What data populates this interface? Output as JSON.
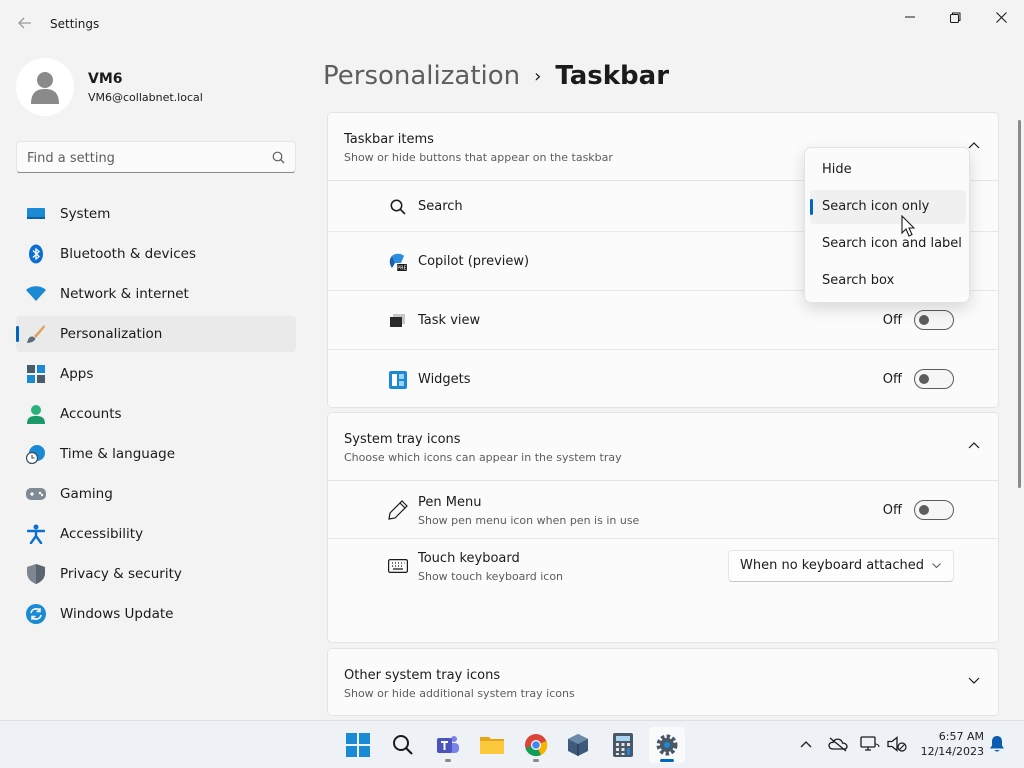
{
  "window": {
    "app_title": "Settings",
    "colors": {
      "accent": "#0067c0",
      "background": "#f3f3f3",
      "card": "#fbfbfb"
    }
  },
  "profile": {
    "name": "VM6",
    "email": "VM6@collabnet.local"
  },
  "search": {
    "placeholder": "Find a setting"
  },
  "nav": {
    "items": [
      {
        "label": "System",
        "icon": "system-icon"
      },
      {
        "label": "Bluetooth & devices",
        "icon": "bluetooth-icon"
      },
      {
        "label": "Network & internet",
        "icon": "wifi-icon"
      },
      {
        "label": "Personalization",
        "icon": "brush-icon",
        "selected": true
      },
      {
        "label": "Apps",
        "icon": "apps-icon"
      },
      {
        "label": "Accounts",
        "icon": "account-icon"
      },
      {
        "label": "Time & language",
        "icon": "globe-clock-icon"
      },
      {
        "label": "Gaming",
        "icon": "gamepad-icon"
      },
      {
        "label": "Accessibility",
        "icon": "accessibility-icon"
      },
      {
        "label": "Privacy & security",
        "icon": "shield-icon"
      },
      {
        "label": "Windows Update",
        "icon": "update-icon"
      }
    ]
  },
  "page": {
    "parent": "Personalization",
    "separator": "›",
    "current": "Taskbar"
  },
  "taskbar_items": {
    "title": "Taskbar items",
    "subtitle": "Show or hide buttons that appear on the taskbar",
    "rows": [
      {
        "label": "Search",
        "icon": "search-icon"
      },
      {
        "label": "Copilot (preview)",
        "icon": "copilot-icon"
      },
      {
        "label": "Task view",
        "icon": "task-view-icon",
        "state": "Off"
      },
      {
        "label": "Widgets",
        "icon": "widgets-icon",
        "state": "Off"
      }
    ]
  },
  "search_dropdown": {
    "options": [
      "Hide",
      "Search icon only",
      "Search icon and label",
      "Search box"
    ],
    "selected": "Search icon only"
  },
  "system_tray": {
    "title": "System tray icons",
    "subtitle": "Choose which icons can appear in the system tray",
    "rows": [
      {
        "label": "Pen Menu",
        "sub": "Show pen menu icon when pen is in use",
        "state": "Off",
        "icon": "pen-icon"
      },
      {
        "label": "Touch keyboard",
        "sub": "Show touch keyboard icon",
        "value": "When no keyboard attached",
        "icon": "keyboard-icon"
      }
    ]
  },
  "other_tray": {
    "title": "Other system tray icons",
    "subtitle": "Show or hide additional system tray icons"
  },
  "taskbar": {
    "apps": [
      "start-icon",
      "taskbar-search-icon",
      "teams-icon",
      "file-explorer-icon",
      "chrome-icon",
      "virtualbox-icon",
      "calculator-icon",
      "settings-icon"
    ],
    "time": "6:57 AM",
    "date": "12/14/2023"
  }
}
